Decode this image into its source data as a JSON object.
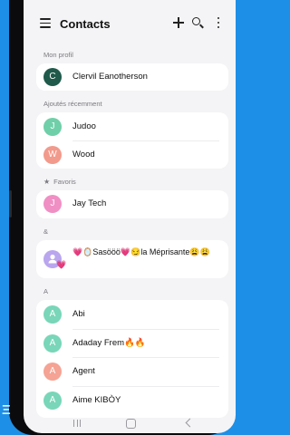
{
  "header": {
    "title": "Contacts",
    "icons": [
      "menu-icon",
      "plus-icon",
      "search-icon",
      "more-icon"
    ]
  },
  "sections": {
    "profile": {
      "label": "Mon profil"
    },
    "recent": {
      "label": "Ajoutés récemment"
    },
    "favorites": {
      "label": "Favoris"
    },
    "amp": {
      "label": "&"
    },
    "a": {
      "label": "A"
    }
  },
  "contacts": {
    "profile": {
      "initial": "C",
      "name": "Clervil Eanotherson",
      "color": "#1f5a4a"
    },
    "judoo": {
      "initial": "J",
      "name": "Judoo",
      "color": "#6fcfa8"
    },
    "wood": {
      "initial": "W",
      "name": "Wood",
      "color": "#f29a8c"
    },
    "jay": {
      "initial": "J",
      "name": "Jay Tech",
      "color": "#f08fc4"
    },
    "sasoo": {
      "line1": "💗🪞Sasööö💗😏la Méprisante😩😩",
      "line2": "💗",
      "color": "#b9a6ee"
    },
    "abi": {
      "initial": "A",
      "name": "Abi",
      "color": "#79d6b8"
    },
    "adaday": {
      "initial": "A",
      "name": "Adaday Frem🔥🔥",
      "color": "#79d6b8"
    },
    "agent": {
      "initial": "A",
      "name": "Agent",
      "color": "#f5a394"
    },
    "aime": {
      "initial": "A",
      "name": "Aime KIBÒY",
      "color": "#79d6b8"
    }
  },
  "navbar": {
    "buttons": [
      "recent-apps-icon",
      "home-icon",
      "back-icon"
    ]
  },
  "colors": {
    "background": "#1e8fe6",
    "screen": "#f4f4f6",
    "card": "#ffffff"
  }
}
